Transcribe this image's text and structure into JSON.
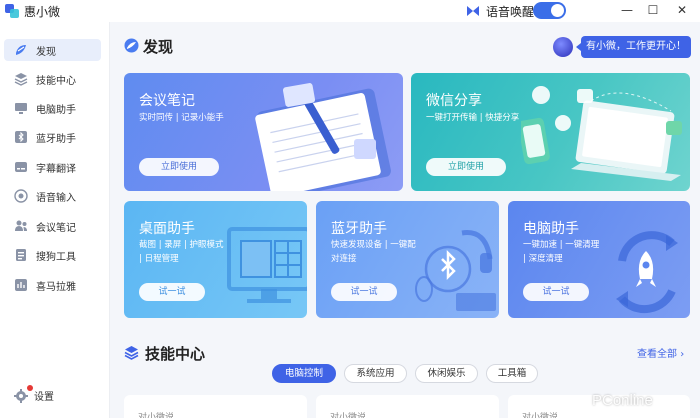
{
  "app": {
    "name": "惠小微"
  },
  "titlebar": {
    "wake_label": "语音唤醒",
    "wake_enabled": true,
    "minimize": "—",
    "maximize": "☐",
    "close": "✕"
  },
  "sidebar": {
    "items": [
      {
        "label": "发现",
        "icon": "discover-icon",
        "active": true
      },
      {
        "label": "技能中心",
        "icon": "layers-icon"
      },
      {
        "label": "电脑助手",
        "icon": "monitor-icon"
      },
      {
        "label": "蓝牙助手",
        "icon": "bluetooth-icon"
      },
      {
        "label": "字幕翻译",
        "icon": "translate-icon"
      },
      {
        "label": "语音输入",
        "icon": "voice-input-icon"
      },
      {
        "label": "会议笔记",
        "icon": "meeting-notes-icon"
      },
      {
        "label": "搜狗工具",
        "icon": "sogou-tool-icon"
      },
      {
        "label": "喜马拉雅",
        "icon": "ximalaya-icon"
      }
    ],
    "settings_label": "设置"
  },
  "main": {
    "title": "发现",
    "assistant_greeting": "有小微，工作更开心！"
  },
  "cards": {
    "meeting": {
      "title": "会议笔记",
      "desc": "实时同传 | 记录小能手",
      "button": "立即使用"
    },
    "wechat": {
      "title": "微信分享",
      "desc": "一键打开传输 | 快捷分享",
      "button": "立即使用"
    },
    "desktop": {
      "title": "桌面助手",
      "desc1": "截图 | 录屏 | 护眼模式",
      "desc2": "| 日程管理",
      "button": "试一试"
    },
    "bluetooth": {
      "title": "蓝牙助手",
      "desc1": "快速发现设备 | 一键配",
      "desc2": "对连接",
      "button": "试一试"
    },
    "pc": {
      "title": "电脑助手",
      "desc1": "一键加速 | 一键清理",
      "desc2": "| 深度清理",
      "button": "试一试"
    }
  },
  "skills": {
    "title": "技能中心",
    "see_all": "查看全部",
    "tabs": [
      "电脑控制",
      "系统应用",
      "休闲娱乐",
      "工具箱"
    ],
    "active_tab": 0,
    "card_label": "对小微说"
  },
  "watermark": "PConline",
  "colors": {
    "accent": "#3f63e6",
    "active_nav_bg": "#e8eefb"
  }
}
